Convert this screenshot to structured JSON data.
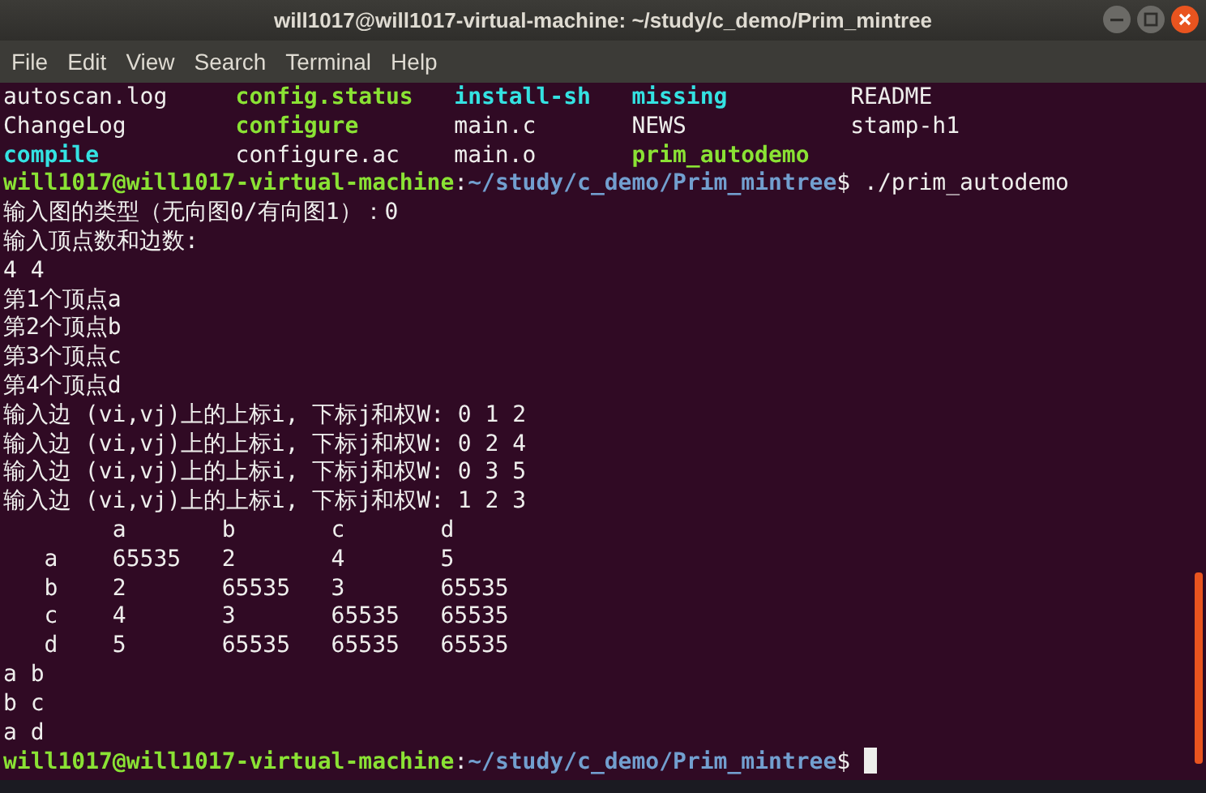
{
  "window": {
    "title": "will1017@will1017-virtual-machine: ~/study/c_demo/Prim_mintree"
  },
  "menu": [
    "File",
    "Edit",
    "View",
    "Search",
    "Terminal",
    "Help"
  ],
  "terminal": {
    "lines": [
      {
        "kind": "ls",
        "entries": [
          {
            "text": "autoscan.log",
            "kind": "plain"
          },
          {
            "text": "config.status",
            "kind": "executable"
          },
          {
            "text": "install-sh",
            "kind": "symlink"
          },
          {
            "text": "missing",
            "kind": "symlink"
          },
          {
            "text": "README",
            "kind": "plain"
          }
        ]
      },
      {
        "kind": "ls",
        "entries": [
          {
            "text": "ChangeLog",
            "kind": "plain"
          },
          {
            "text": "configure",
            "kind": "executable"
          },
          {
            "text": "main.c",
            "kind": "plain"
          },
          {
            "text": "NEWS",
            "kind": "plain"
          },
          {
            "text": "stamp-h1",
            "kind": "plain"
          }
        ]
      },
      {
        "kind": "ls",
        "entries": [
          {
            "text": "compile",
            "kind": "symlink"
          },
          {
            "text": "configure.ac",
            "kind": "plain"
          },
          {
            "text": "main.o",
            "kind": "plain"
          },
          {
            "text": "prim_autodemo",
            "kind": "executable"
          }
        ]
      },
      {
        "kind": "prompt",
        "user_host": "will1017@will1017-virtual-machine",
        "colon": ":",
        "path": "~/study/c_demo/Prim_mintree",
        "sigil": "$",
        "command": "./prim_autodemo"
      },
      {
        "kind": "output",
        "text": "输入图的类型（无向图0/有向图1）：0"
      },
      {
        "kind": "output",
        "text": "输入顶点数和边数:"
      },
      {
        "kind": "output",
        "text": "4 4"
      },
      {
        "kind": "output",
        "text": "第1个顶点a"
      },
      {
        "kind": "output",
        "text": "第2个顶点b"
      },
      {
        "kind": "output",
        "text": "第3个顶点c"
      },
      {
        "kind": "output",
        "text": "第4个顶点d"
      },
      {
        "kind": "output",
        "text": "输入边 (vi,vj)上的上标i, 下标j和权W: 0 1 2"
      },
      {
        "kind": "output",
        "text": "输入边 (vi,vj)上的上标i, 下标j和权W: 0 2 4"
      },
      {
        "kind": "output",
        "text": "输入边 (vi,vj)上的上标i, 下标j和权W: 0 3 5"
      },
      {
        "kind": "output",
        "text": "输入边 (vi,vj)上的上标i, 下标j和权W: 1 2 3"
      },
      {
        "kind": "output",
        "text": "        a       b       c       d"
      },
      {
        "kind": "output",
        "text": "   a    65535   2       4       5"
      },
      {
        "kind": "output",
        "text": "   b    2       65535   3       65535"
      },
      {
        "kind": "output",
        "text": "   c    4       3       65535   65535"
      },
      {
        "kind": "output",
        "text": "   d    5       65535   65535   65535"
      },
      {
        "kind": "output",
        "text": "a b"
      },
      {
        "kind": "output",
        "text": "b c"
      },
      {
        "kind": "output",
        "text": "a d"
      },
      {
        "kind": "prompt",
        "user_host": "will1017@will1017-virtual-machine",
        "colon": ":",
        "path": "~/study/c_demo/Prim_mintree",
        "sigil": "$"
      }
    ]
  }
}
